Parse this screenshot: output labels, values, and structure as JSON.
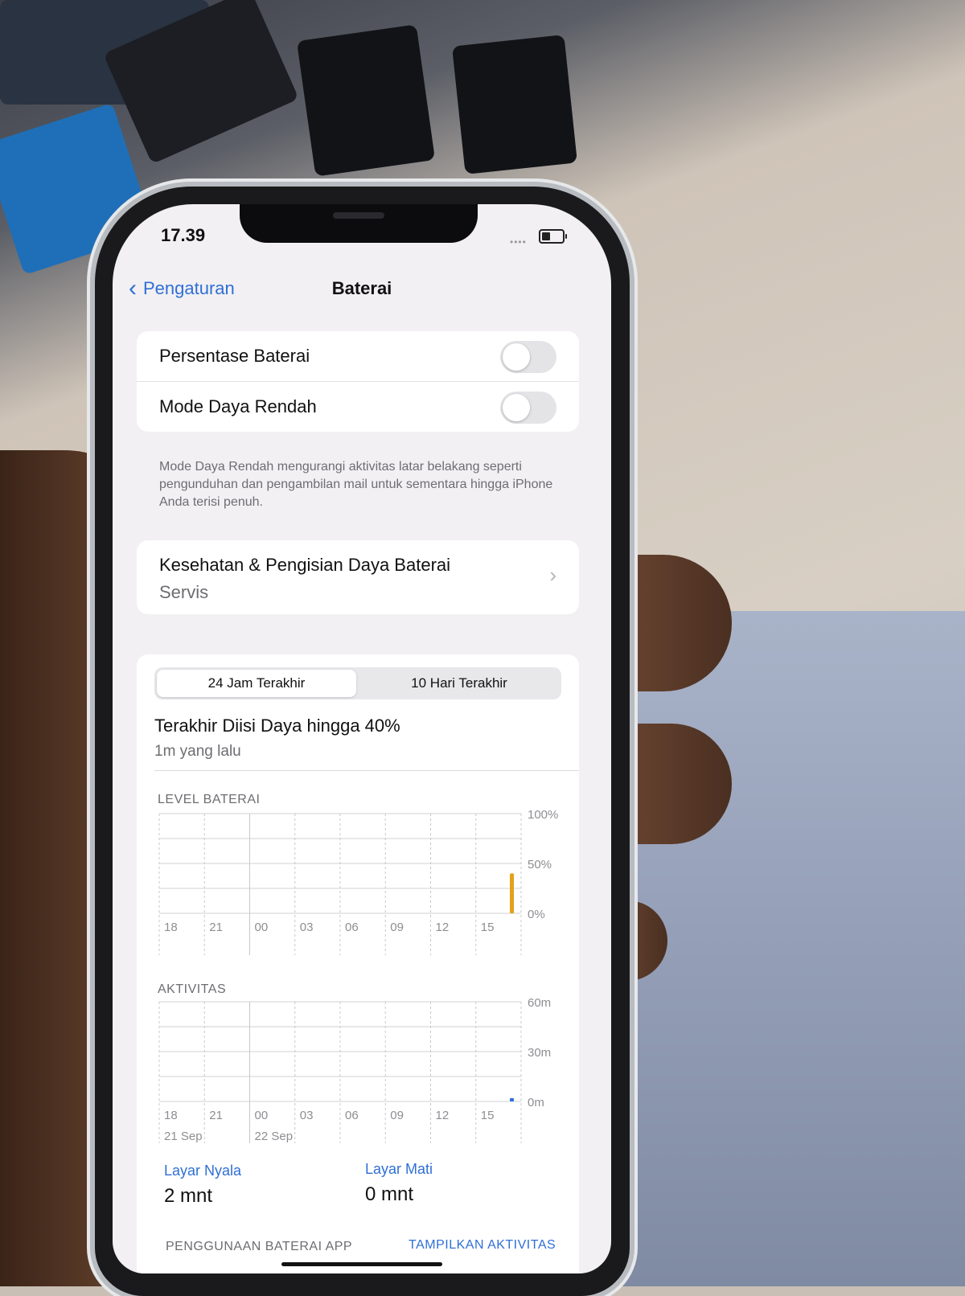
{
  "status_bar": {
    "time": "17.39",
    "battery_level": 0.4
  },
  "nav": {
    "back_label": "Pengaturan",
    "title": "Baterai"
  },
  "settings": {
    "battery_percentage_label": "Persentase Baterai",
    "battery_percentage_on": false,
    "low_power_label": "Mode Daya Rendah",
    "low_power_on": false,
    "low_power_note": "Mode Daya Rendah mengurangi aktivitas latar belakang seperti pengunduhan dan pengambilan mail untuk sementara hingga iPhone Anda terisi penuh."
  },
  "health": {
    "title": "Kesehatan & Pengisian Daya Baterai",
    "subtitle": "Servis"
  },
  "usage": {
    "tabs": [
      "24 Jam Terakhir",
      "10 Hari Terakhir"
    ],
    "selected_tab": 0,
    "last_charged": "Terakhir Diisi Daya hingga 40%",
    "last_charged_ago": "1m yang lalu",
    "screen_on_label": "Layar Nyala",
    "screen_on_value": "2 mnt",
    "screen_off_label": "Layar Mati",
    "screen_off_value": "0 mnt",
    "footer_left": "PENGGUNAAN BATERAI APP",
    "footer_right": "TAMPILKAN AKTIVITAS"
  },
  "colors": {
    "accent": "#2f6fd6",
    "battery_bar": "#e3a21a",
    "activity_bar": "#2f6fd6"
  },
  "chart_data": [
    {
      "type": "bar",
      "title": "LEVEL BATERAI",
      "categories": [
        "18",
        "21",
        "00",
        "03",
        "06",
        "09",
        "12",
        "15"
      ],
      "y_ticks": [
        "100%",
        "50%",
        "0%"
      ],
      "ylim": [
        0,
        100
      ],
      "series": [
        {
          "values": [
            0,
            0,
            0,
            0,
            0,
            0,
            0,
            40
          ]
        }
      ]
    },
    {
      "type": "bar",
      "title": "AKTIVITAS",
      "categories": [
        "18",
        "21",
        "00",
        "03",
        "06",
        "09",
        "12",
        "15"
      ],
      "date_labels": [
        "21 Sep",
        "22 Sep"
      ],
      "y_ticks": [
        "60m",
        "30m",
        "0m"
      ],
      "ylim": [
        0,
        60
      ],
      "series": [
        {
          "values": [
            0,
            0,
            0,
            0,
            0,
            0,
            0,
            2
          ]
        }
      ]
    }
  ]
}
